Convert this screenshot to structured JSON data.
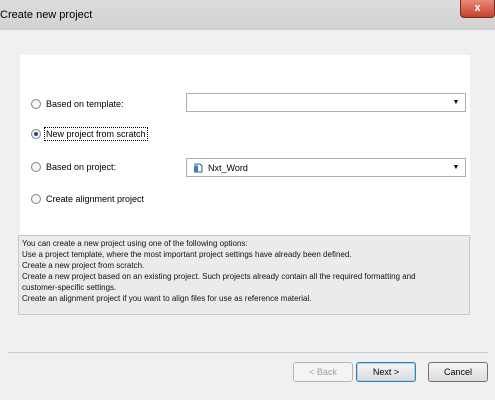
{
  "window": {
    "title": "Create new project",
    "close_label": "x"
  },
  "options": {
    "template": {
      "label": "Based on template:",
      "selected": false
    },
    "scratch": {
      "label": "New project from scratch",
      "selected": true
    },
    "project": {
      "label": "Based on project:",
      "selected": false
    },
    "alignment": {
      "label": "Create alignment project",
      "selected": false
    }
  },
  "template_combo": {
    "value": ""
  },
  "project_combo": {
    "value": "Nxt_Word",
    "icon": "project-icon"
  },
  "description": {
    "lines": [
      "You can create a new project using one of the following options:",
      "Use a project template, where the most important project settings have already been defined.",
      "Create a new project from scratch.",
      "Create a new project based on an existing project. Such projects already contain all the required formatting and",
      "customer-specific settings.",
      "Create an alignment project if you want to align files for use as reference material."
    ]
  },
  "buttons": {
    "back": "< Back",
    "next": "Next >",
    "cancel": "Cancel"
  }
}
